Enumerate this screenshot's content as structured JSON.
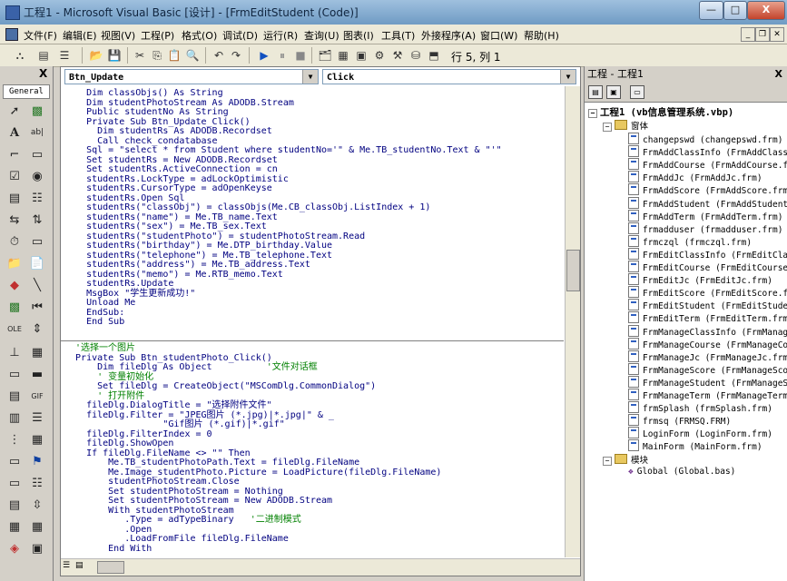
{
  "window": {
    "title": "工程1 - Microsoft Visual Basic [设计] - [FrmEditStudent (Code)]",
    "minimize": "—",
    "maximize": "□",
    "close": "X"
  },
  "menubar": {
    "items": [
      "文件(F)",
      "编辑(E)",
      "视图(V)",
      "工程(P)",
      "格式(O)",
      "调试(D)",
      "运行(R)",
      "查询(U)",
      "图表(I)",
      "工具(T)",
      "外接程序(A)",
      "窗口(W)",
      "帮助(H)"
    ]
  },
  "toolbar": {
    "cursor_position": "行 5, 列 1"
  },
  "toolbox": {
    "tab_label": "General",
    "close": "X"
  },
  "code_window": {
    "object_combo": "Btn_Update",
    "procedure_combo": "Click",
    "lines_top": [
      "    Dim classObjs() As String",
      "    Dim studentPhotoStream As ADODB.Stream",
      "    Public studentNo As String",
      "    Private Sub Btn_Update_Click()",
      "      Dim studentRs As ADODB.Recordset",
      "      Call check_condatabase",
      "    Sql = \"select * from Student where studentNo='\" & Me.TB_studentNo.Text & \"'\"",
      "    Set studentRs = New ADODB.Recordset",
      "    Set studentRs.ActiveConnection = cn",
      "    studentRs.LockType = adLockOptimistic",
      "    studentRs.CursorType = adOpenKeyse",
      "    studentRs.Open Sql",
      "    studentRs(\"classObj\") = classObjs(Me.CB_classObj.ListIndex + 1)",
      "    studentRs(\"name\") = Me.TB_name.Text",
      "    studentRs(\"sex\") = Me.TB_sex.Text",
      "    studentRs(\"studentPhoto\") = studentPhotoStream.Read",
      "    studentRs(\"birthday\") = Me.DTP_birthday.Value",
      "    studentRs(\"telephone\") = Me.TB_telephone.Text",
      "    studentRs(\"address\") = Me.TB_address.Text",
      "    studentRs(\"memo\") = Me.RTB_memo.Text",
      "    studentRs.Update",
      "    MsgBox \"学生更新成功!\"",
      "    Unload Me",
      "    EndSub:",
      "    End Sub"
    ],
    "lines_bottom": [
      "  '选择一个图片",
      "  Private Sub Btn_studentPhoto_Click()",
      "      Dim fileDlg As Object          '文件对话框",
      "      ' 变量初始化",
      "      Set fileDlg = CreateObject(\"MSComDlg.CommonDialog\")",
      "      ' 打开附件",
      "    fileDlg.DialogTitle = \"选择附件文件\"",
      "    fileDlg.Filter = \"JPEG图片 (*.jpg)|*.jpg|\" & _",
      "                  \"Gif图片 (*.gif)|*.gif\"",
      "    fileDlg.FilterIndex = 0",
      "    fileDlg.ShowOpen",
      "    If fileDlg.FileName <> \"\" Then",
      "        Me.TB_studentPhotoPath.Text = fileDlg.FileName",
      "        Me.Image_studentPhoto.Picture = LoadPicture(fileDlg.FileName)",
      "        studentPhotoStream.Close",
      "        Set studentPhotoStream = Nothing",
      "        Set studentPhotoStream = New ADODB.Stream",
      "        With studentPhotoStream",
      "           .Type = adTypeBinary   '二进制模式",
      "           .Open",
      "           .LoadFromFile fileDlg.FileName",
      "        End With"
    ]
  },
  "project": {
    "title": "工程 - 工程1",
    "close": "X",
    "root": "工程1 (vb信息管理系统.vbp)",
    "forms_folder": "窗体",
    "modules_folder": "模块",
    "forms": [
      "changepswd (changepswd.frm)",
      "FrmAddClassInfo (FrmAddClass",
      "FrmAddCourse (FrmAddCourse.f",
      "FrmAddJc (FrmAddJc.frm)",
      "FrmAddScore (FrmAddScore.frm",
      "FrmAddStudent (FrmAddStudent",
      "FrmAddTerm (FrmAddTerm.frm)",
      "frmadduser (frmadduser.frm)",
      "frmczql (frmczql.frm)",
      "FrmEditClassInfo (FrmEditCla",
      "FrmEditCourse (FrmEditCourse",
      "FrmEditJc (FrmEditJc.frm)",
      "FrmEditScore (FrmEditScore.f",
      "FrmEditStudent (FrmEditStude",
      "FrmEditTerm (FrmEditTerm.frm",
      "FrmManageClassInfo (FrmManag",
      "FrmManageCourse (FrmManageCo",
      "FrmManageJc (FrmManageJc.frm",
      "FrmManageScore (FrmManageSco",
      "FrmManageStudent (FrmManageS",
      "FrmManageTerm (FrmManageTerm",
      "frmSplash (frmSplash.frm)",
      "frmsq (FRMSQ.FRM)",
      "LoginForm (LoginForm.frm)",
      "MainForm (MainForm.frm)"
    ],
    "modules": [
      "Global (Global.bas)"
    ]
  }
}
